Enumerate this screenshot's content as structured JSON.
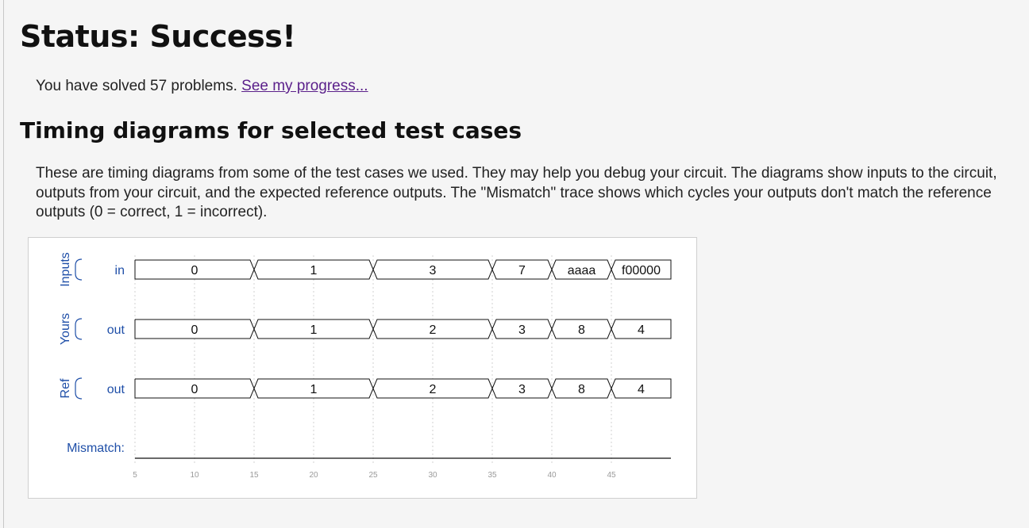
{
  "status": {
    "title": "Status: Success!"
  },
  "progress": {
    "text": "You have solved 57 problems. ",
    "link_label": "See my progress..."
  },
  "section": {
    "title": "Timing diagrams for selected test cases",
    "description": "These are timing diagrams from some of the test cases we used. They may help you debug your circuit. The diagrams show inputs to the circuit, outputs from your circuit, and the expected reference outputs. The \"Mismatch\" trace shows which cycles your outputs don't match the reference outputs (0 = correct, 1 = incorrect)."
  },
  "chart_data": {
    "type": "timing",
    "time_ticks": [
      5,
      10,
      15,
      20,
      25,
      30,
      35,
      40,
      45
    ],
    "time_range": [
      5,
      50
    ],
    "grid": true,
    "groups": [
      {
        "label": "Inputs",
        "signals": [
          "in"
        ]
      },
      {
        "label": "Yours",
        "signals": [
          "out"
        ]
      },
      {
        "label": "Ref",
        "signals": [
          "out"
        ]
      }
    ],
    "signals": [
      {
        "group": "Inputs",
        "name": "in",
        "segments": [
          {
            "start": 5,
            "end": 15,
            "value": "0"
          },
          {
            "start": 15,
            "end": 25,
            "value": "1"
          },
          {
            "start": 25,
            "end": 35,
            "value": "3"
          },
          {
            "start": 35,
            "end": 40,
            "value": "7"
          },
          {
            "start": 40,
            "end": 45,
            "value": "aaaa"
          },
          {
            "start": 45,
            "end": 50,
            "value": "f00000"
          }
        ]
      },
      {
        "group": "Yours",
        "name": "out",
        "segments": [
          {
            "start": 5,
            "end": 15,
            "value": "0"
          },
          {
            "start": 15,
            "end": 25,
            "value": "1"
          },
          {
            "start": 25,
            "end": 35,
            "value": "2"
          },
          {
            "start": 35,
            "end": 40,
            "value": "3"
          },
          {
            "start": 40,
            "end": 45,
            "value": "8"
          },
          {
            "start": 45,
            "end": 50,
            "value": "4"
          }
        ]
      },
      {
        "group": "Ref",
        "name": "out",
        "segments": [
          {
            "start": 5,
            "end": 15,
            "value": "0"
          },
          {
            "start": 15,
            "end": 25,
            "value": "1"
          },
          {
            "start": 25,
            "end": 35,
            "value": "2"
          },
          {
            "start": 35,
            "end": 40,
            "value": "3"
          },
          {
            "start": 40,
            "end": 45,
            "value": "8"
          },
          {
            "start": 45,
            "end": 50,
            "value": "4"
          }
        ]
      }
    ],
    "mismatch": {
      "label": "Mismatch:",
      "values": [
        0
      ]
    },
    "colors": {
      "label": "#1f4fa8",
      "trace": "#111111",
      "grid": "#d0d0d0"
    }
  }
}
